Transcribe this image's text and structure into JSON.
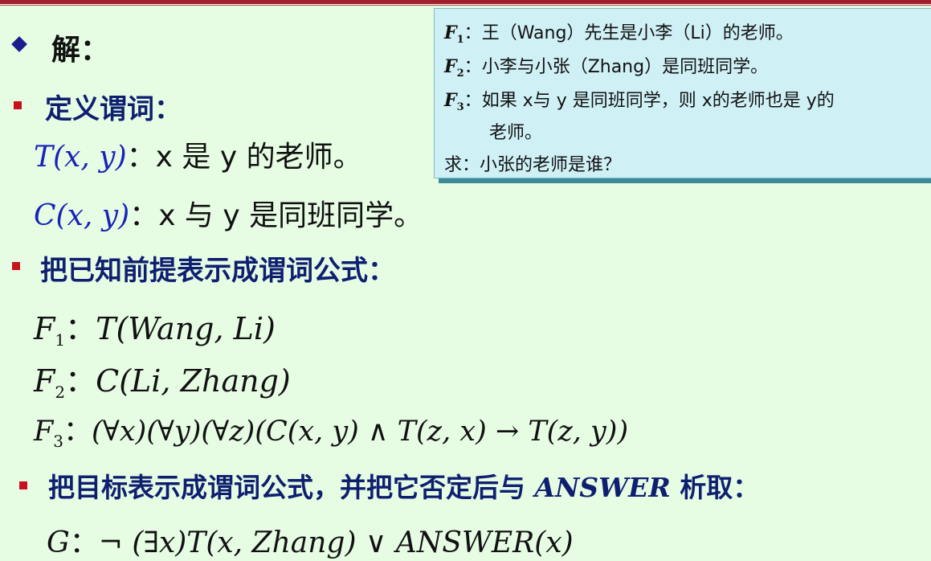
{
  "header": {
    "solution_label": "解："
  },
  "sections": {
    "define_predicates": "定义谓词：",
    "premises_heading": "把已知前提表示成谓词公式：",
    "goal_heading_prefix": "把目标表示成谓词公式，并把它否定后与",
    "goal_heading_answer": "ANSWER",
    "goal_heading_suffix": "析取："
  },
  "predicates": [
    {
      "symbol": "T(x, y)",
      "separator": "：",
      "text": "x 是  y 的老师。"
    },
    {
      "symbol": "C(x, y)",
      "separator": "：",
      "text": "x  与  y 是同班同学。"
    }
  ],
  "formulas": {
    "f1": {
      "name": "F",
      "index": "1",
      "sep": "：",
      "expr": "T(Wang, Li)"
    },
    "f2": {
      "name": "F",
      "index": "2",
      "sep": "：",
      "expr": "C(Li, Zhang)"
    },
    "f3": {
      "name": "F",
      "index": "3",
      "sep": "：",
      "expr": "(∀x)(∀y)(∀z)(C(x, y) ∧ T(z, x) → T(z, y))"
    },
    "goal": {
      "name": "G",
      "sep": "：",
      "expr": "¬ (∃x)T(x, Zhang) ∨ ANSWER(x)"
    }
  },
  "callout": {
    "lines": [
      {
        "label": "F",
        "index": "1",
        "sep": "：",
        "text": "王（Wang）先生是小李（Li）的老师。"
      },
      {
        "label": "F",
        "index": "2",
        "sep": "：",
        "text": "小李与小张（Zhang）是同班同学。"
      },
      {
        "label": "F",
        "index": "3",
        "sep": "：",
        "text": "如果 x与 y 是同班同学，则 x的老师也是 y的"
      },
      {
        "label": "",
        "index": "",
        "sep": "",
        "text": "老师。"
      }
    ],
    "question": "求：小张的老师是谁？"
  },
  "colors": {
    "background": "#e6fde4",
    "heading_navy": "#0f1f70",
    "predicate_blue": "#1a23b8",
    "bullet_red": "#c8101e",
    "top_bar": "#a1202e",
    "callout_bg": "#cff0f5"
  }
}
